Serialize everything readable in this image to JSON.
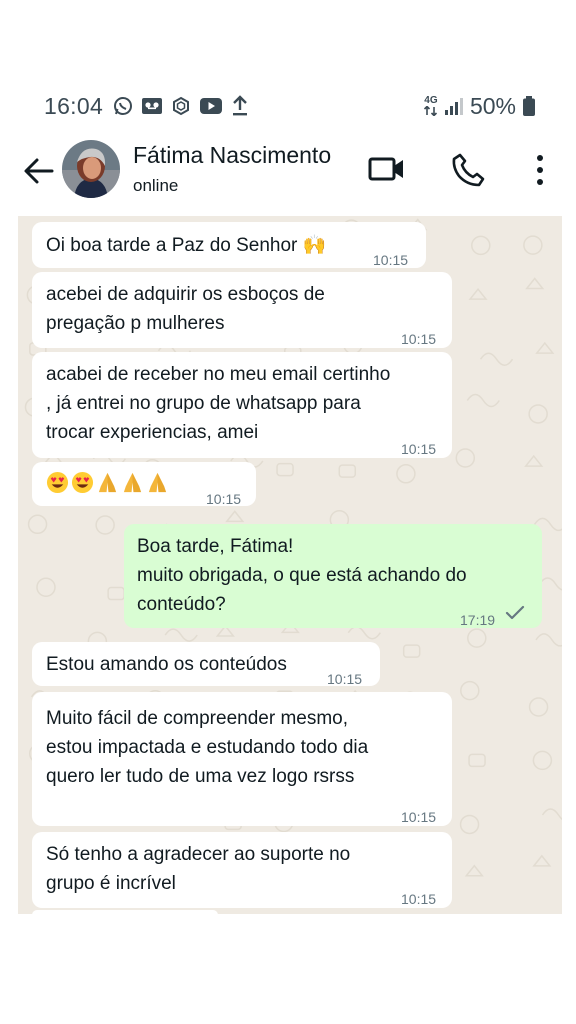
{
  "status_bar": {
    "time": "16:04",
    "network": "4G",
    "battery": "50%"
  },
  "header": {
    "contact_name": "Fátima Nascimento",
    "contact_status": "online"
  },
  "messages": [
    {
      "direction": "in",
      "text": "Oi boa tarde a Paz do Senhor 🙌",
      "time": "10:15"
    },
    {
      "direction": "in",
      "text": "acebei de adquirir os esboços de\npregação p mulheres",
      "time": "10:15"
    },
    {
      "direction": "in",
      "text": "acabei de receber no meu email certinho\n, já entrei no grupo de whatsapp para\ntrocar experiencias, amei",
      "time": "10:15"
    },
    {
      "direction": "in",
      "text": "😍😍🙏🙏🙏",
      "time": "10:15"
    },
    {
      "direction": "out",
      "text": "Boa tarde, Fátima!\nmuito obrigada, o que está achando do\nconteúdo?",
      "time": "17:19",
      "status": "sent"
    },
    {
      "direction": "in",
      "text": "Estou amando os conteúdos",
      "time": "10:15"
    },
    {
      "direction": "in",
      "text": "Muito fácil de compreender mesmo,\nestou impactada e estudando todo dia\nquero ler tudo de uma vez logo rsrss",
      "time": "10:15"
    },
    {
      "direction": "in",
      "text": "Só tenho a agradecer ao suporte no\ngrupo é incrível",
      "time": "10:15"
    }
  ],
  "colors": {
    "incoming_bubble": "#ffffff",
    "outgoing_bubble": "#d9fdd3",
    "chat_background": "#efeae2",
    "timestamp": "#667781",
    "icon": "#111b21"
  }
}
